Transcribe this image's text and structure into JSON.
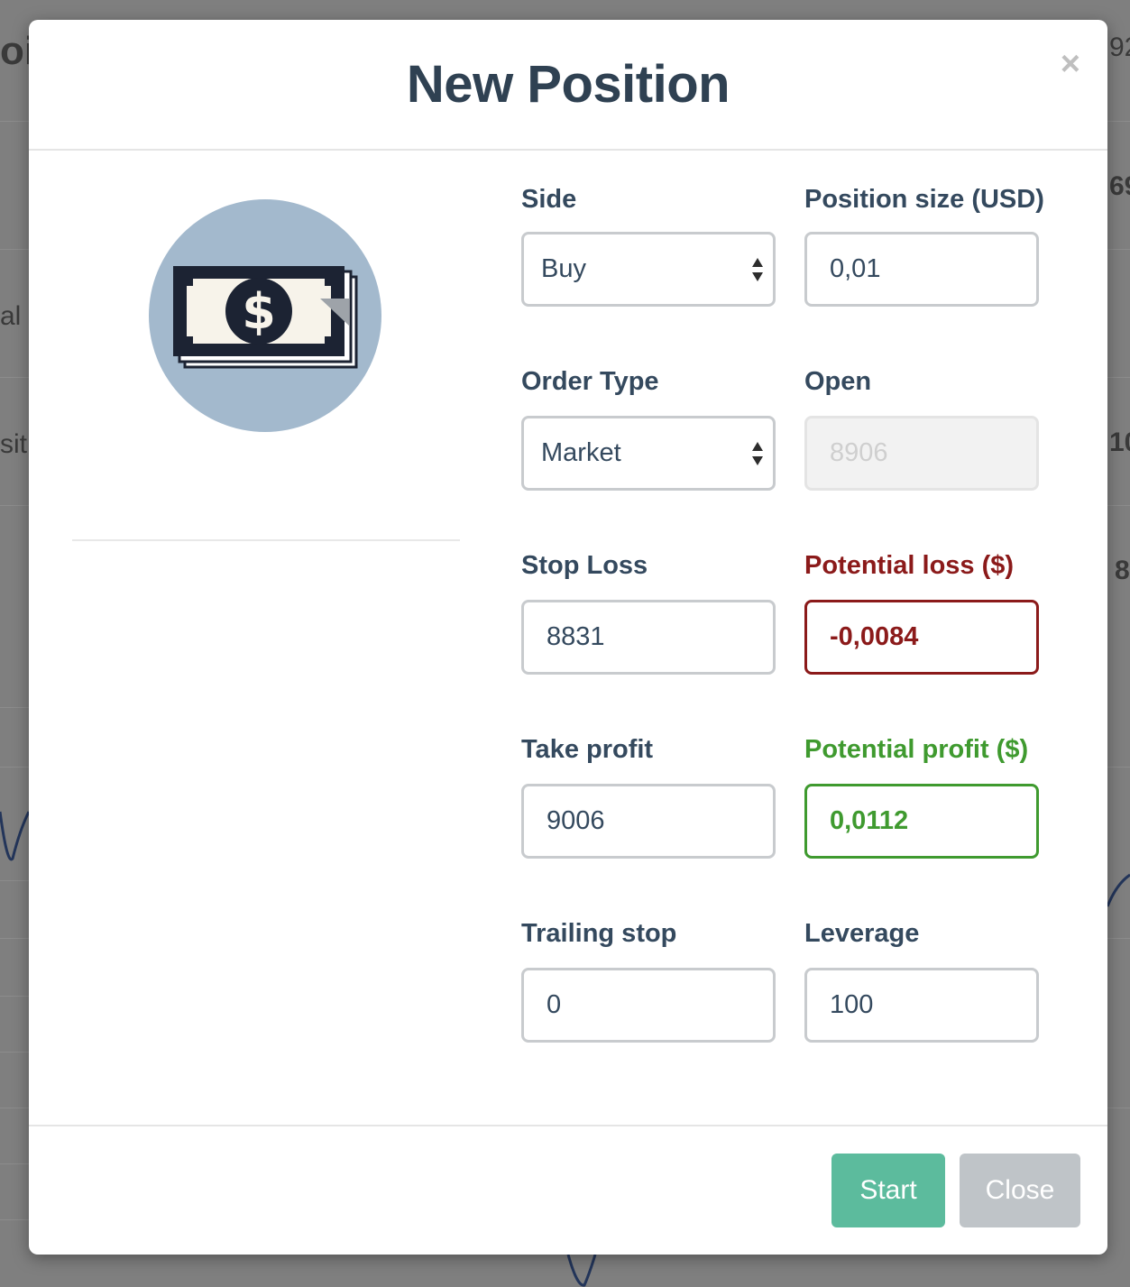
{
  "background": {
    "fragments": [
      "oi",
      "al",
      "siti",
      "92",
      "69",
      "10",
      "8"
    ]
  },
  "modal": {
    "title": "New Position",
    "close_icon": "×"
  },
  "form": {
    "side": {
      "label": "Side",
      "value": "Buy"
    },
    "position_size": {
      "label": "Position size (USD)",
      "value": "0,01"
    },
    "order_type": {
      "label": "Order Type",
      "value": "Market"
    },
    "open": {
      "label": "Open",
      "placeholder": "8906"
    },
    "stop_loss": {
      "label": "Stop Loss",
      "value": "8831"
    },
    "potential_loss": {
      "label": "Potential loss ($)",
      "value": "-0,0084"
    },
    "take_profit": {
      "label": "Take profit",
      "value": "9006"
    },
    "potential_profit": {
      "label": "Potential profit ($)",
      "value": "0,0112"
    },
    "trailing_stop": {
      "label": "Trailing stop",
      "value": "0"
    },
    "leverage": {
      "label": "Leverage",
      "value": "100"
    }
  },
  "footer": {
    "start_label": "Start",
    "close_label": "Close"
  },
  "colors": {
    "loss": "#8b1a1a",
    "profit": "#3f9a2f",
    "start_button": "#5cbb9d",
    "close_button": "#bfc4c8",
    "avatar_bg": "#a3b9cd"
  },
  "icons": {
    "avatar": "money-bill-icon",
    "select_arrows": "updown-arrows-icon"
  }
}
